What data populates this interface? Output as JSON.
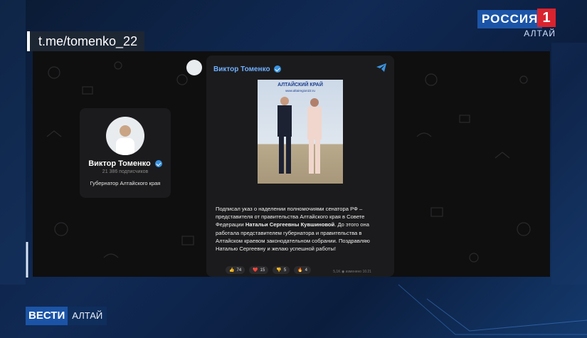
{
  "url": "t.me/tomenko_22",
  "channel_logo": {
    "name": "РОССИЯ",
    "number": "1",
    "region": "АЛТАЙ"
  },
  "profile": {
    "name": "Виктор Томенко",
    "subscribers": "21 386 подписчиков",
    "bio": "Губернатор Алтайского края"
  },
  "post": {
    "author": "Виктор Томенко",
    "image_banner_title": "АЛТАЙСКИЙ КРАЙ",
    "image_banner_url": "www.altairegion22.ru",
    "text_part1": "Подписал указ о наделении полномочиями сенатора РФ – представителя от правительства Алтайского края в Совете Федерации ",
    "text_bold": "Натальи Сергеевны Кувшиновой",
    "text_part2": ". До этого она работала представителем губернатора и правительства в Алтайском краевом законодательном собрании. Поздравляю Наталью Сергеевну и желаю успешной работы!",
    "reactions": [
      {
        "icon": "thumbs-up-icon",
        "glyph": "👍",
        "count": "74"
      },
      {
        "icon": "heart-icon",
        "glyph": "❤️",
        "count": "15"
      },
      {
        "icon": "thumbs-down-icon",
        "glyph": "👎",
        "count": "5"
      },
      {
        "icon": "fire-icon",
        "glyph": "🔥",
        "count": "4"
      }
    ],
    "views": "5,1K",
    "meta_time": "изменено 16:21"
  },
  "news_logo": {
    "brand": "ВЕСТИ",
    "region": "АЛТАЙ"
  },
  "colors": {
    "accent": "#1b54a7",
    "link": "#6fb0ff",
    "red": "#d9232e"
  }
}
